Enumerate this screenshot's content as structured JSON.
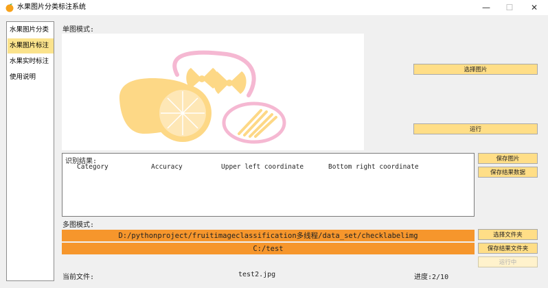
{
  "window": {
    "title": "水果图片分类标注系统",
    "minimize_glyph": "—",
    "maximize_glyph": "☐",
    "close_glyph": "✕"
  },
  "sidebar": {
    "items": [
      {
        "label": "水果图片分类",
        "active": false
      },
      {
        "label": "水果图片标注",
        "active": true
      },
      {
        "label": "水果实时标注",
        "active": false
      },
      {
        "label": "使用说明",
        "active": false
      }
    ]
  },
  "single_mode": {
    "label": "单图模式:",
    "select_image_button": "选择图片",
    "run_button": "运行"
  },
  "results": {
    "title": "识别结果:",
    "columns": [
      "Category",
      "Accuracy",
      "Upper left coordinate",
      "Bottom right coordinate"
    ]
  },
  "side_buttons": {
    "save_image": "保存图片",
    "save_result_data": "保存结果数据"
  },
  "multi_mode": {
    "label": "多图模式:",
    "source_path": "D:/pythonproject/fruitimageclassification多线程/data_set/checklabelimg",
    "output_path": "C:/test",
    "select_folder_button": "选择文件夹",
    "save_result_folder_button": "保存结果文件夹",
    "running_button": "运行中"
  },
  "status": {
    "current_file_label": "当前文件:",
    "current_file": "test2.jpg",
    "progress_label": "进度:",
    "progress_current": 2,
    "progress_total": 10,
    "progress_text": "进度:2/10"
  },
  "colors": {
    "accent_yellow": "#ffde87",
    "active_nav": "#fbe38c",
    "path_orange": "#f6962c",
    "logo_yellow": "#fdd886",
    "logo_pink": "#f5b8d2"
  },
  "icons": {
    "app_icon": "orange-fruit-icon",
    "preview_image": "lemon-pasta-logo-image"
  }
}
